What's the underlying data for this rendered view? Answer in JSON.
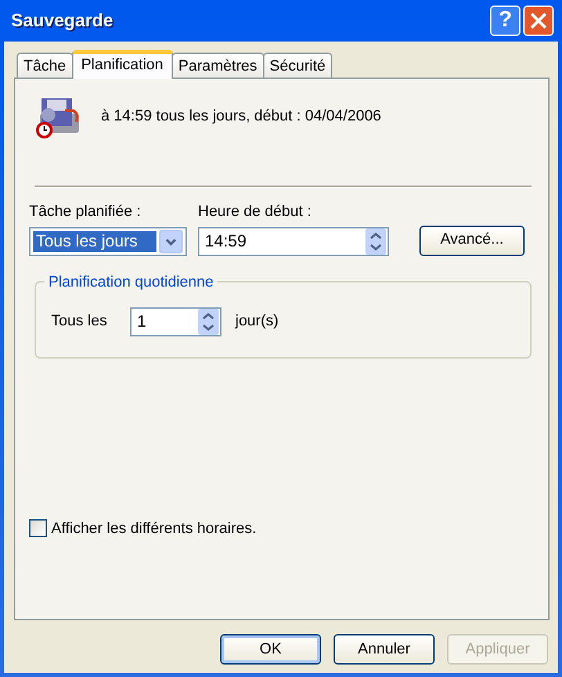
{
  "window": {
    "title": "Sauvegarde",
    "help_button": "?"
  },
  "tabs": [
    {
      "label": "Tâche",
      "selected": false
    },
    {
      "label": "Planification",
      "selected": true
    },
    {
      "label": "Paramètres",
      "selected": false
    },
    {
      "label": "Sécurité",
      "selected": false
    }
  ],
  "summary": "à 14:59 tous les jours, début : 04/04/2006",
  "schedule": {
    "label": "Tâche planifiée :",
    "value": "Tous les jours"
  },
  "start_time": {
    "label": "Heure de début :",
    "value": "14:59"
  },
  "advanced_button": "Avancé...",
  "daily": {
    "legend": "Planification quotidienne",
    "every_label": "Tous les",
    "every_value": "1",
    "unit": "jour(s)"
  },
  "show_schedules": {
    "label": "Afficher les différents horaires.",
    "checked": false
  },
  "buttons": [
    {
      "label": "OK",
      "default": true,
      "disabled": false
    },
    {
      "label": "Annuler",
      "default": false,
      "disabled": false
    },
    {
      "label": "Appliquer",
      "default": false,
      "disabled": true
    }
  ]
}
